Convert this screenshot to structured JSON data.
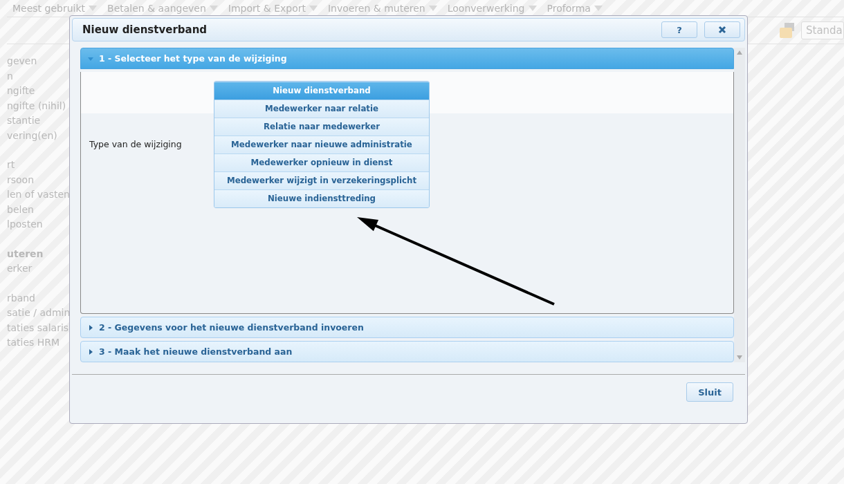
{
  "menu": [
    {
      "label": "Meest gebruikt"
    },
    {
      "label": "Betalen & aangeven"
    },
    {
      "label": "Import & Export"
    },
    {
      "label": "Invoeren & muteren"
    },
    {
      "label": "Loonverwerking"
    },
    {
      "label": "Proforma"
    }
  ],
  "toolbar": {
    "field": "Standa"
  },
  "sidebar": {
    "groups": [
      {
        "items": [
          {
            "label": "geven",
            "bold": false
          },
          {
            "label": "n",
            "bold": false
          },
          {
            "label": "ngifte",
            "bold": false
          },
          {
            "label": "ngifte (nihil)",
            "bold": false
          },
          {
            "label": "stantie",
            "bold": false
          },
          {
            "label": "vering(en)",
            "bold": false
          }
        ]
      },
      {
        "items": [
          {
            "label": "rt",
            "bold": false
          },
          {
            "label": "rsoon",
            "bold": false
          },
          {
            "label": "len of vasten",
            "bold": false
          },
          {
            "label": "belen",
            "bold": false
          },
          {
            "label": "lposten",
            "bold": false
          }
        ]
      },
      {
        "items": [
          {
            "label": "uteren",
            "bold": true
          },
          {
            "label": "erker",
            "bold": false
          }
        ]
      },
      {
        "items": [
          {
            "label": "rband",
            "bold": false
          },
          {
            "label": "satie / admin",
            "bold": false
          },
          {
            "label": "taties salaris",
            "bold": false
          },
          {
            "label": "taties HRM",
            "bold": false
          }
        ]
      }
    ]
  },
  "dialog": {
    "title": "Nieuw dienstverband",
    "help_button": "?",
    "sections": [
      {
        "title": "1 - Selecteer het type van de wijziging",
        "expanded": true,
        "field_label": "Type van de wijziging",
        "options": [
          {
            "label": "Nieuw dienstverband",
            "selected": true
          },
          {
            "label": "Medewerker naar relatie",
            "selected": false
          },
          {
            "label": "Relatie naar medewerker",
            "selected": false
          },
          {
            "label": "Medewerker naar nieuwe administratie",
            "selected": false
          },
          {
            "label": "Medewerker opnieuw in dienst",
            "selected": false
          },
          {
            "label": "Medewerker wijzigt in verzekeringsplicht",
            "selected": false
          },
          {
            "label": "Nieuwe indiensttreding",
            "selected": false
          }
        ]
      },
      {
        "title": "2 - Gegevens voor het nieuwe dienstverband invoeren",
        "expanded": false
      },
      {
        "title": "3 - Maak het nieuwe dienstverband aan",
        "expanded": false
      }
    ],
    "close_label": "Sluit"
  }
}
